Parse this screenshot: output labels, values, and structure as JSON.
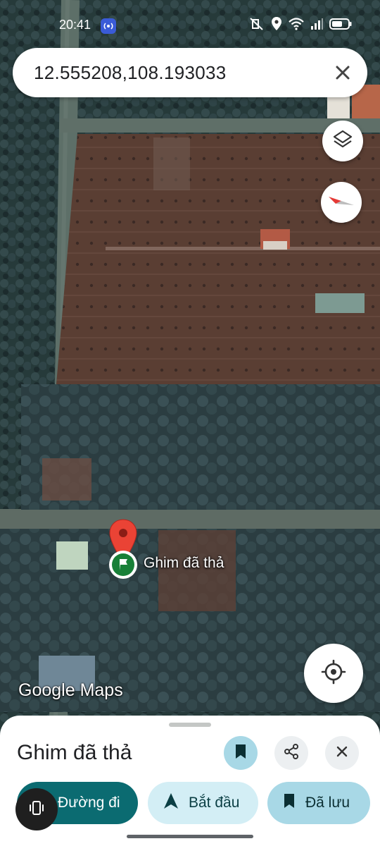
{
  "status_bar": {
    "time": "20:41"
  },
  "search": {
    "query": "12.555208,108.193033"
  },
  "map": {
    "pin_label": "Ghim đã thả",
    "watermark_google": "Google",
    "watermark_maps": "Maps"
  },
  "sheet": {
    "title": "Ghim đã thả",
    "chips": [
      {
        "label": "Đường đi",
        "icon": "directions-icon"
      },
      {
        "label": "Bắt đầu",
        "icon": "navigation-arrow-icon"
      },
      {
        "label": "Đã lưu",
        "icon": "bookmark-icon"
      }
    ]
  },
  "colors": {
    "accent_teal": "#0b6b71",
    "chip_light": "#d3eef5",
    "chip_saved": "#a8d8e6",
    "pin_red": "#ea4335",
    "pin_green": "#188038"
  }
}
